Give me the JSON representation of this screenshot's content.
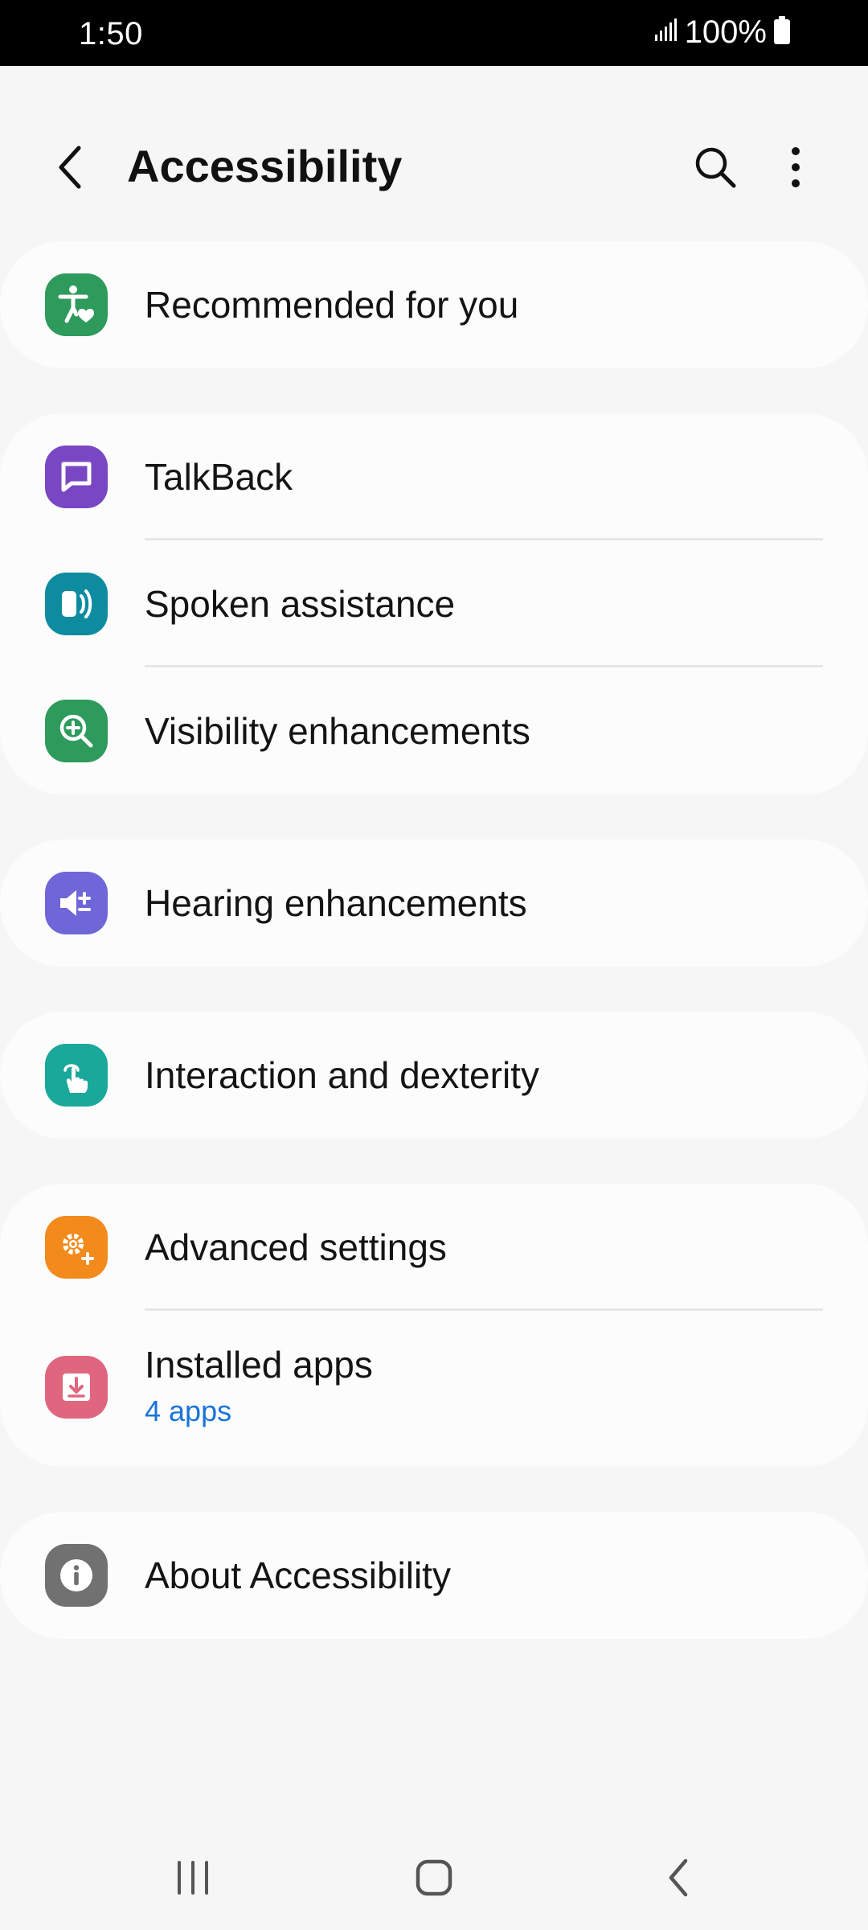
{
  "status_bar": {
    "time": "1:50",
    "battery": "100%",
    "icons": [
      "signal-icon",
      "battery-icon"
    ]
  },
  "header": {
    "title": "Accessibility",
    "icons": [
      "back-icon",
      "search-icon",
      "more-options-icon"
    ]
  },
  "items": {
    "recommended": {
      "label": "Recommended for you",
      "icon": "accessibility-heart-icon",
      "color": "#2e9a5c"
    },
    "talkback": {
      "label": "TalkBack",
      "icon": "chat-bubble-icon",
      "color": "#7a47c4"
    },
    "spoken": {
      "label": "Spoken assistance",
      "icon": "speaker-waves-icon",
      "color": "#0d8ca0"
    },
    "visibility": {
      "label": "Visibility enhancements",
      "icon": "magnifier-plus-icon",
      "color": "#2e9a5c"
    },
    "hearing": {
      "label": "Hearing enhancements",
      "icon": "volume-plus-minus-icon",
      "color": "#6f66d8"
    },
    "interaction": {
      "label": "Interaction and dexterity",
      "icon": "touch-hand-icon",
      "color": "#1aa89a"
    },
    "advanced": {
      "label": "Advanced settings",
      "icon": "gear-plus-icon",
      "color": "#f28a1c"
    },
    "installed": {
      "label": "Installed apps",
      "subtitle": "4 apps",
      "icon": "download-tray-icon",
      "color": "#e0667f"
    },
    "about": {
      "label": "About Accessibility",
      "icon": "info-icon",
      "color": "#717171"
    }
  },
  "accent_color": "#1a73d9",
  "nav_bar": {
    "icons": [
      "recent-apps-icon",
      "home-icon",
      "back-nav-icon"
    ]
  }
}
